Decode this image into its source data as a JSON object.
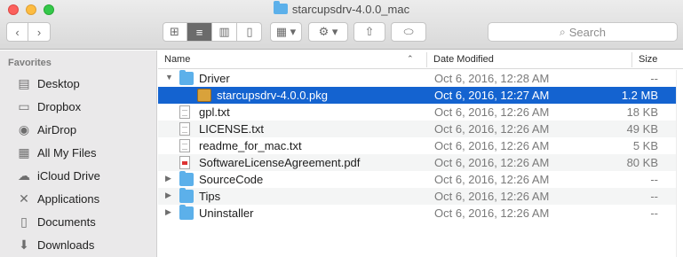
{
  "window": {
    "title": "starcupsdrv-4.0.0_mac"
  },
  "toolbar": {
    "back_glyph": "‹",
    "forward_glyph": "›",
    "view_icon_glyph": "⊞",
    "view_list_glyph": "≡",
    "view_column_glyph": "▥",
    "view_cover_glyph": "▯",
    "group_glyph": "▦ ▾",
    "action_glyph": "⚙ ▾",
    "share_glyph": "⇧",
    "tag_glyph": "⬭"
  },
  "search": {
    "placeholder": "Search",
    "icon_glyph": "⌕"
  },
  "sidebar": {
    "heading": "Favorites",
    "items": [
      {
        "label": "Desktop",
        "icon": "desktop-icon",
        "glyph": "▤"
      },
      {
        "label": "Dropbox",
        "icon": "folder-icon",
        "glyph": "▭"
      },
      {
        "label": "AirDrop",
        "icon": "airdrop-icon",
        "glyph": "◉"
      },
      {
        "label": "All My Files",
        "icon": "all-files-icon",
        "glyph": "▦"
      },
      {
        "label": "iCloud Drive",
        "icon": "cloud-icon",
        "glyph": "☁"
      },
      {
        "label": "Applications",
        "icon": "applications-icon",
        "glyph": "✕"
      },
      {
        "label": "Documents",
        "icon": "documents-icon",
        "glyph": "▯"
      },
      {
        "label": "Downloads",
        "icon": "downloads-icon",
        "glyph": "⬇"
      }
    ]
  },
  "list": {
    "columns": {
      "name": "Name",
      "date": "Date Modified",
      "size": "Size"
    },
    "sort_glyph": "⌃",
    "rows": [
      {
        "name": "Driver",
        "date": "Oct 6, 2016, 12:28 AM",
        "size": "--",
        "type": "folder",
        "disclosure": "▼",
        "indent": 0,
        "selected": false
      },
      {
        "name": "starcupsdrv-4.0.0.pkg",
        "date": "Oct 6, 2016, 12:27 AM",
        "size": "1.2 MB",
        "type": "pkg",
        "disclosure": "",
        "indent": 1,
        "selected": true
      },
      {
        "name": "gpl.txt",
        "date": "Oct 6, 2016, 12:26 AM",
        "size": "18 KB",
        "type": "doc",
        "disclosure": "",
        "indent": 0,
        "selected": false
      },
      {
        "name": "LICENSE.txt",
        "date": "Oct 6, 2016, 12:26 AM",
        "size": "49 KB",
        "type": "doc",
        "disclosure": "",
        "indent": 0,
        "selected": false
      },
      {
        "name": "readme_for_mac.txt",
        "date": "Oct 6, 2016, 12:26 AM",
        "size": "5 KB",
        "type": "doc",
        "disclosure": "",
        "indent": 0,
        "selected": false
      },
      {
        "name": "SoftwareLicenseAgreement.pdf",
        "date": "Oct 6, 2016, 12:26 AM",
        "size": "80 KB",
        "type": "pdf",
        "disclosure": "",
        "indent": 0,
        "selected": false
      },
      {
        "name": "SourceCode",
        "date": "Oct 6, 2016, 12:26 AM",
        "size": "--",
        "type": "folder",
        "disclosure": "▶",
        "indent": 0,
        "selected": false
      },
      {
        "name": "Tips",
        "date": "Oct 6, 2016, 12:26 AM",
        "size": "--",
        "type": "folder",
        "disclosure": "▶",
        "indent": 0,
        "selected": false
      },
      {
        "name": "Uninstaller",
        "date": "Oct 6, 2016, 12:26 AM",
        "size": "--",
        "type": "folder",
        "disclosure": "▶",
        "indent": 0,
        "selected": false
      }
    ]
  },
  "colors": {
    "selection": "#1463d0",
    "folder": "#5cb0ea",
    "sidebar_bg": "#eae9ea"
  }
}
